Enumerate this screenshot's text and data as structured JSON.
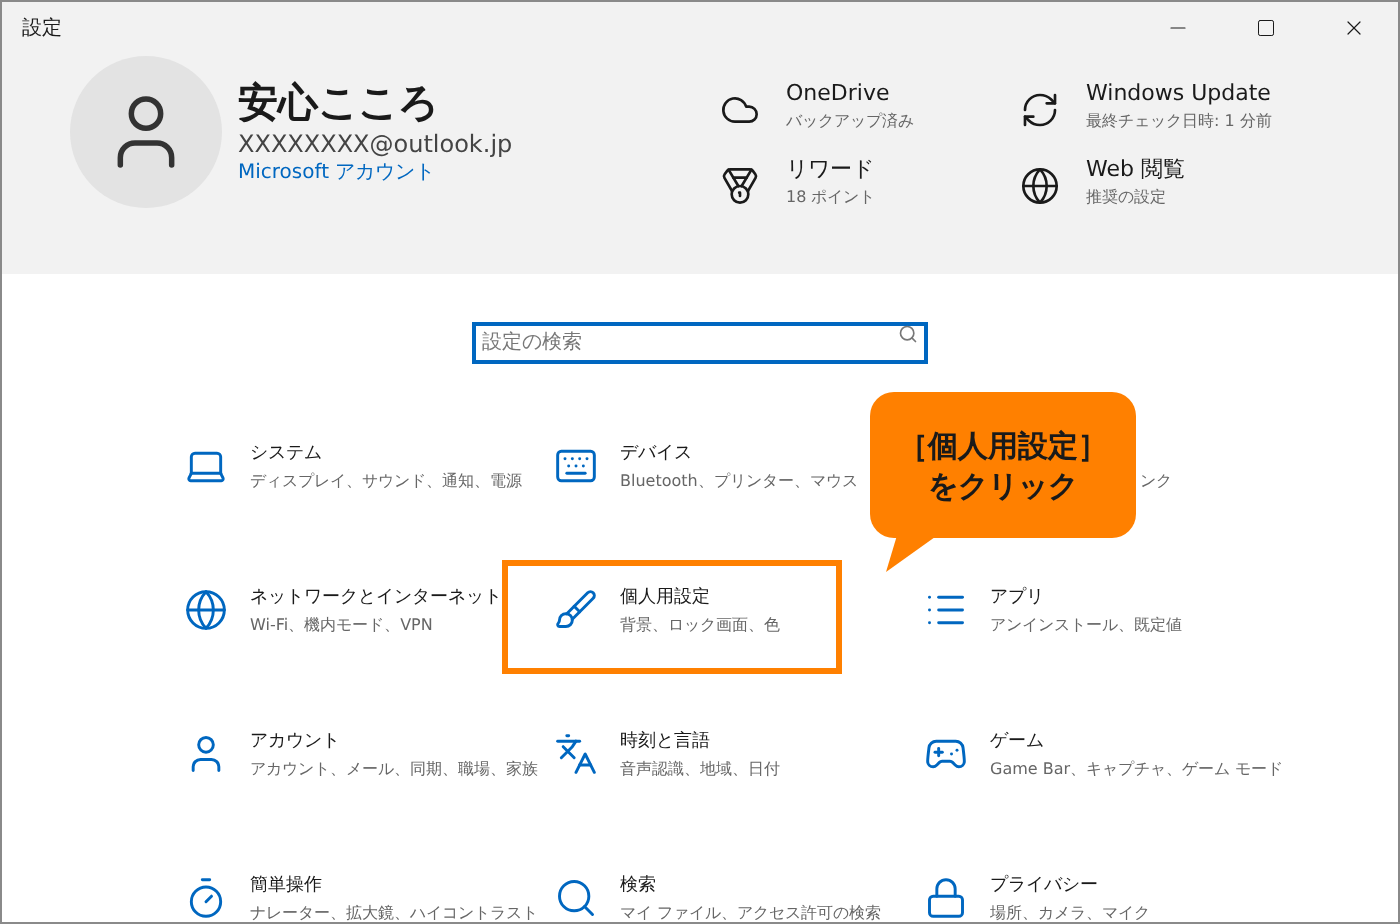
{
  "window": {
    "title": "設定"
  },
  "account": {
    "name": "安心こころ",
    "email": "XXXXXXXX@outlook.jp",
    "link": "Microsoft アカウント"
  },
  "status": [
    {
      "title": "OneDrive",
      "detail": "バックアップ済み"
    },
    {
      "title": "Windows Update",
      "detail": "最終チェック日時: 1 分前"
    },
    {
      "title": "リワード",
      "detail": "18 ポイント"
    },
    {
      "title": "Web 閲覧",
      "detail": "推奨の設定"
    }
  ],
  "search": {
    "placeholder": "設定の検索"
  },
  "categories": [
    {
      "title": "システム",
      "detail": "ディスプレイ、サウンド、通知、電源",
      "highlighted": false
    },
    {
      "title": "デバイス",
      "detail": "Bluetooth、プリンター、マウス",
      "highlighted": false
    },
    {
      "detail": "ンク"
    },
    {
      "title": "ネットワークとインターネット",
      "detail": "Wi-Fi、機内モード、VPN",
      "highlighted": false
    },
    {
      "title": "個人用設定",
      "detail": "背景、ロック画面、色",
      "highlighted": true
    },
    {
      "title": "アプリ",
      "detail": "アンインストール、既定値",
      "highlighted": false
    },
    {
      "title": "アカウント",
      "detail": "アカウント、メール、同期、職場、家族",
      "highlighted": false
    },
    {
      "title": "時刻と言語",
      "detail": "音声認識、地域、日付",
      "highlighted": false
    },
    {
      "title": "ゲーム",
      "detail": "Game Bar、キャプチャ、ゲーム モード",
      "highlighted": false
    },
    {
      "title": "簡単操作",
      "detail": "ナレーター、拡大鏡、ハイコントラスト",
      "highlighted": false
    },
    {
      "title": "検索",
      "detail": "マイ ファイル、アクセス許可の検索",
      "highlighted": false
    },
    {
      "title": "プライバシー",
      "detail": "場所、カメラ、マイク",
      "highlighted": false
    }
  ],
  "callout": {
    "lines": [
      "［個人用設定］",
      "をクリック"
    ]
  }
}
